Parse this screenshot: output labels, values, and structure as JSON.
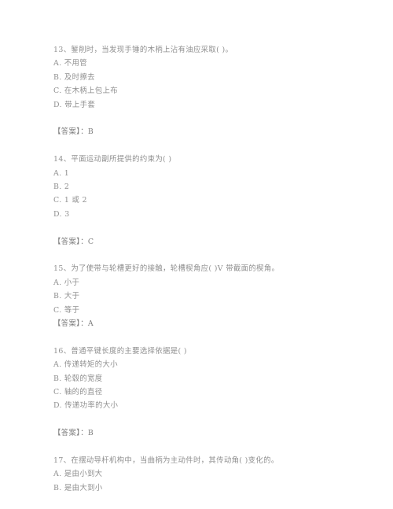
{
  "document": {
    "type": "exam-question-sheet",
    "background_color": "#ffffff",
    "text_color": "#8f8f8f",
    "questions": [
      {
        "number": "13",
        "stem": "13、錾削时，当发现手锤的木柄上沾有油应采取(    )。",
        "options": [
          "A. 不用管",
          "B. 及时擦去",
          "C. 在木柄上包上布",
          "D. 带上手套"
        ],
        "gap_before_answer": true,
        "answer": "【答案】：B"
      },
      {
        "number": "14",
        "stem": "14、平面运动副所提供的约束为(    )",
        "options": [
          "A. 1",
          "B. 2",
          "C. 1 或 2",
          "D. 3"
        ],
        "gap_before_answer": true,
        "answer": "【答案】：C"
      },
      {
        "number": "15",
        "stem": "15、为了使带与轮槽更好的接触，轮槽楔角应(    )V 带截面的楔角。",
        "options": [
          "A. 小于",
          "B. 大于",
          "C. 等于"
        ],
        "gap_before_answer": false,
        "answer": "【答案】：A"
      },
      {
        "number": "16",
        "stem": "16、普通平键长度的主要选择依据是(    )",
        "options": [
          "A. 传递转矩的大小",
          "B. 轮毂的宽度",
          "C. 轴的的直径",
          "D. 传递功率的大小"
        ],
        "gap_before_answer": true,
        "answer": "【答案】：B"
      },
      {
        "number": "17",
        "stem": "17、在摆动导杆机构中，当曲柄为主动件时，其传动角(    )变化的。",
        "options": [
          "A. 是由小到大",
          "B. 是由大到小"
        ],
        "gap_before_answer": false,
        "answer": ""
      }
    ]
  }
}
